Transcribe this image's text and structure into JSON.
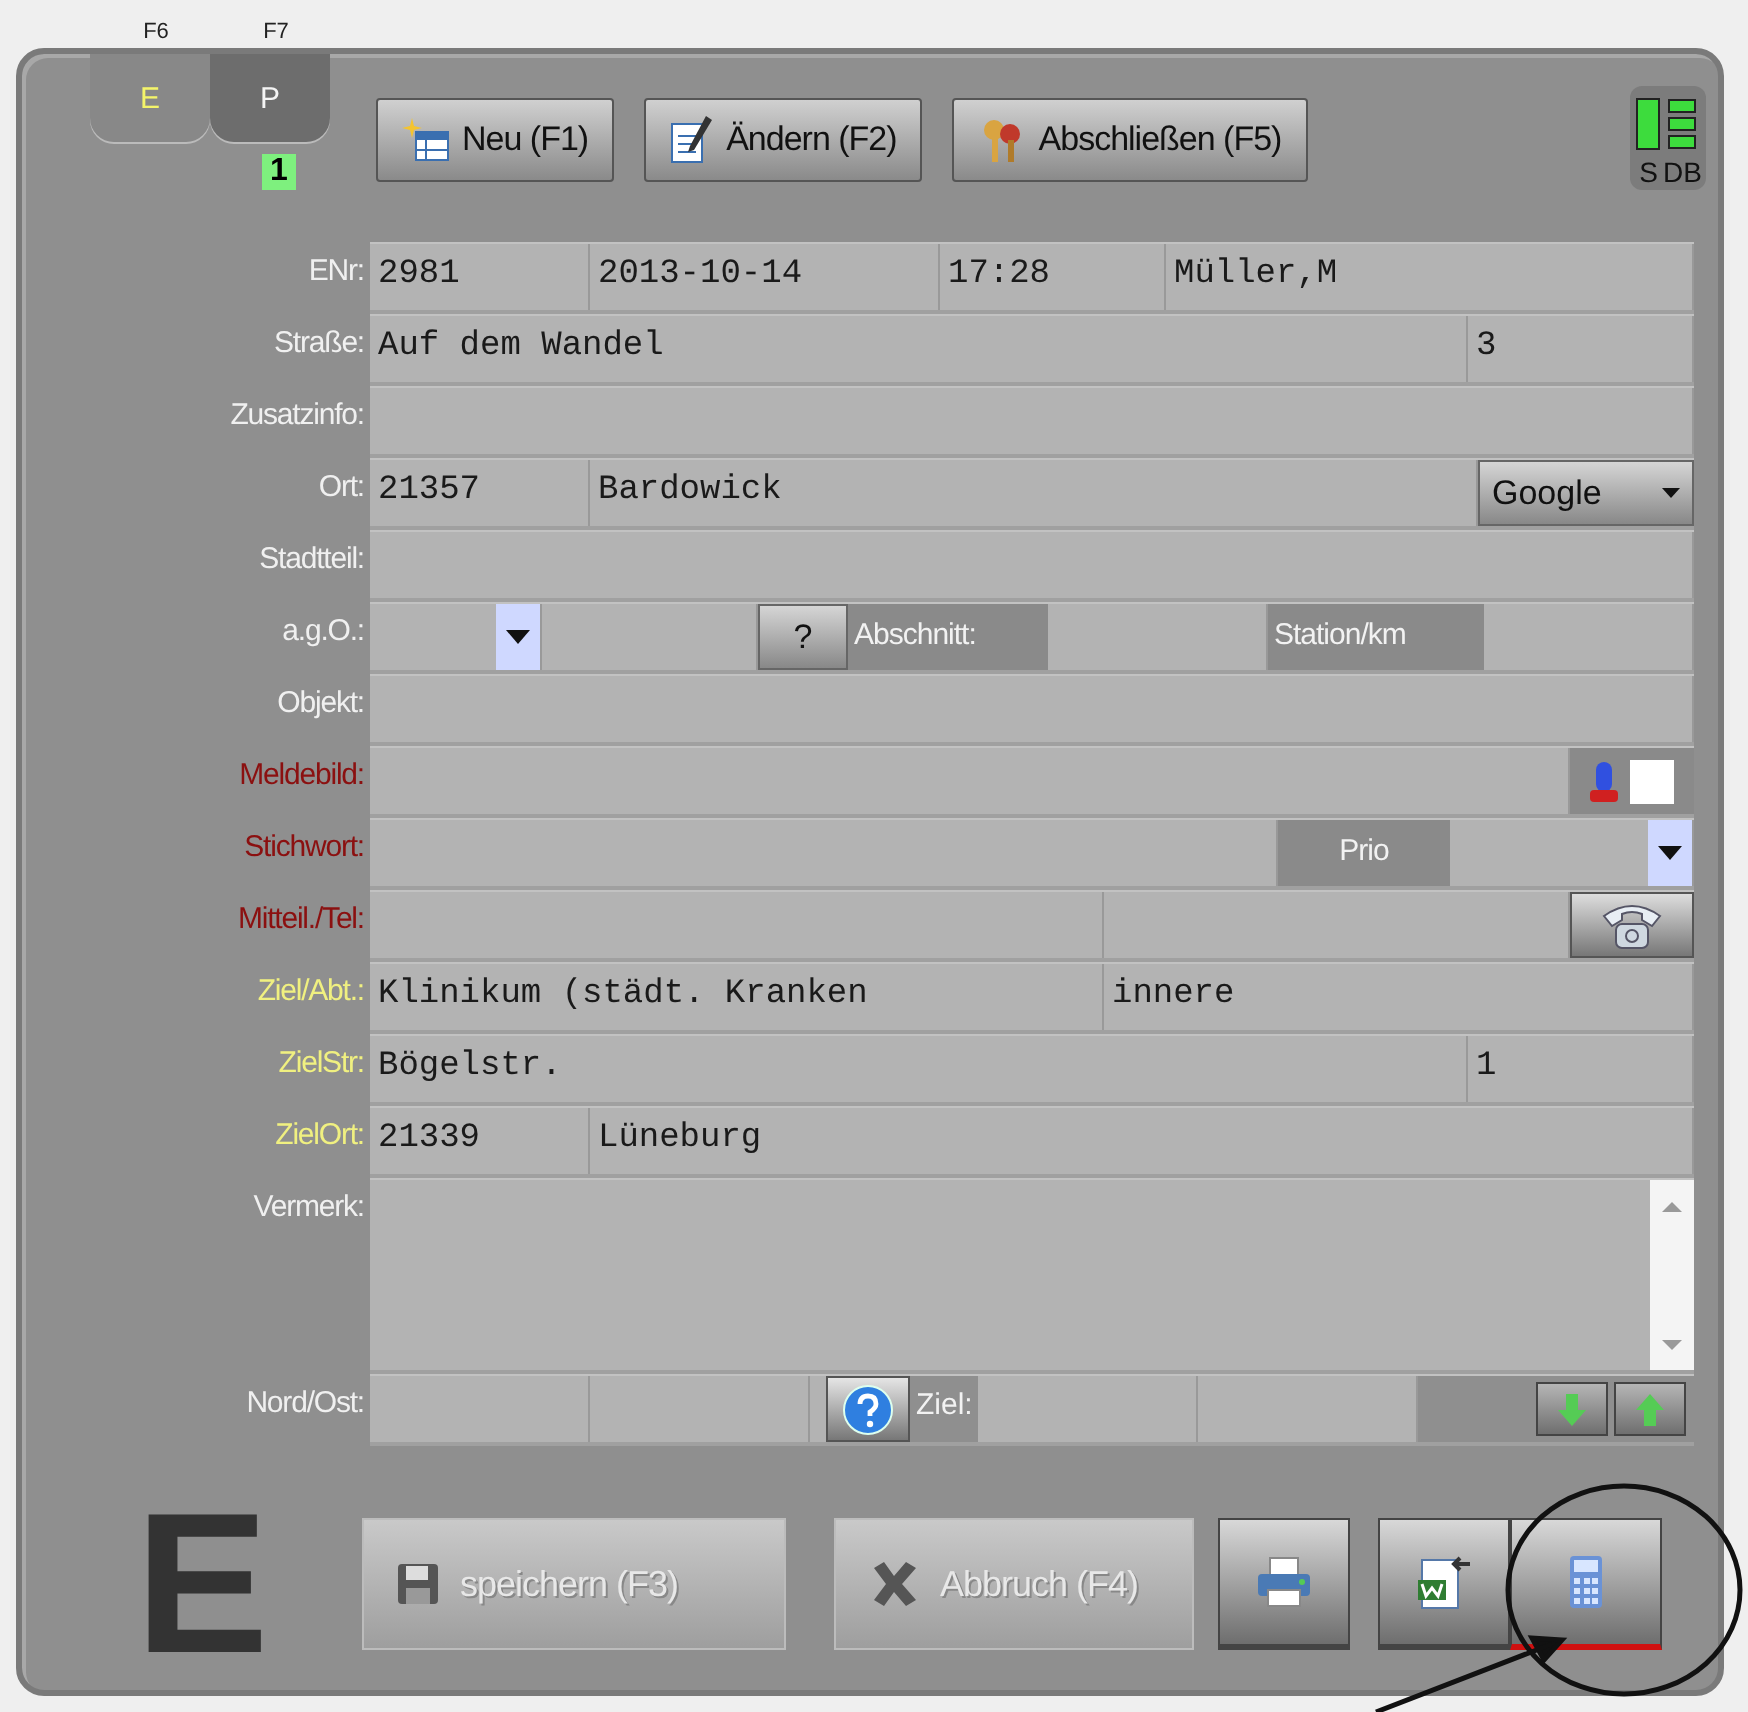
{
  "tabs": [
    {
      "key": "F6",
      "label": "E",
      "selected": true
    },
    {
      "key": "F7",
      "label": "P",
      "selected": false
    }
  ],
  "counter": "1",
  "toolbar": [
    {
      "kind": "new",
      "label": "Neu (F1)"
    },
    {
      "kind": "edit",
      "label": "Ändern (F2)"
    },
    {
      "kind": "close",
      "label": "Abschließen (F5)"
    }
  ],
  "status": {
    "s": "S",
    "db": "DB"
  },
  "rows": [
    {
      "label": "ENr:",
      "color": "#f0f0f0",
      "cells": [
        {
          "kind": "short",
          "value": "2981"
        },
        {
          "kind": "date",
          "value": "2013-10-14"
        },
        {
          "kind": "mid",
          "value": "17:28"
        },
        {
          "kind": "field",
          "value": "Müller,M"
        }
      ]
    },
    {
      "label": "Straße:",
      "color": "#f0f0f0",
      "cells": [
        {
          "kind": "field",
          "value": "Auf dem Wandel"
        },
        {
          "kind": "mid",
          "value": "3"
        }
      ]
    },
    {
      "label": "Zusatzinfo:",
      "color": "#f0f0f0",
      "cells": [
        {
          "kind": "field"
        }
      ]
    },
    {
      "label": "Ort:",
      "color": "#f0f0f0",
      "cells": [
        {
          "kind": "short",
          "value": "21357"
        },
        {
          "kind": "field",
          "value": "Bardowick"
        },
        {
          "kind": "menu-button",
          "label": "Google"
        }
      ]
    },
    {
      "label": "Stadtteil:",
      "color": "#f0f0f0",
      "cells": [
        {
          "kind": "field"
        }
      ]
    },
    {
      "label": "a.g.O.:",
      "color": "#f0f0f0",
      "cells": [
        {
          "kind": "combo"
        },
        {
          "kind": "small"
        },
        {
          "kind": "help-button",
          "label": "?"
        },
        {
          "kind": "caption",
          "label": "Abschnitt:"
        },
        {
          "kind": "short"
        },
        {
          "kind": "caption",
          "label": "Station/km"
        },
        {
          "kind": "field"
        }
      ]
    },
    {
      "label": "Objekt:",
      "color": "#f0f0f0",
      "cells": [
        {
          "kind": "field"
        }
      ]
    },
    {
      "label": "Meldebild:",
      "color": "#8b1010",
      "cells": [
        {
          "kind": "field"
        },
        {
          "kind": "siren-check",
          "checked": false
        }
      ]
    },
    {
      "label": "Stichwort:",
      "color": "#8b1010",
      "cells": [
        {
          "kind": "field"
        },
        {
          "kind": "caption",
          "label": "Prio"
        },
        {
          "kind": "combo-wide"
        }
      ]
    },
    {
      "label": "Mitteil./Tel:",
      "color": "#8b1010",
      "cells": [
        {
          "kind": "wide"
        },
        {
          "kind": "field"
        },
        {
          "kind": "phone-button"
        }
      ]
    },
    {
      "label": "Ziel/Abt.:",
      "color": "#f0f080",
      "cells": [
        {
          "kind": "wide",
          "value": "Klinikum (städt. Kranken"
        },
        {
          "kind": "field",
          "value": "innere"
        }
      ]
    },
    {
      "label": "ZielStr:",
      "color": "#f0f080",
      "cells": [
        {
          "kind": "field",
          "value": "Bögelstr."
        },
        {
          "kind": "mid",
          "value": "1"
        }
      ]
    },
    {
      "label": "ZielOrt:",
      "color": "#f0f080",
      "cells": [
        {
          "kind": "short",
          "value": "21339"
        },
        {
          "kind": "field",
          "value": "Lüneburg"
        }
      ]
    },
    {
      "label": "Vermerk:",
      "color": "#f0f0f0",
      "cells": [
        {
          "kind": "memo"
        }
      ]
    },
    {
      "label": "Nord/Ost:",
      "color": "#f0f0f0",
      "cells": [
        {
          "kind": "short"
        },
        {
          "kind": "short"
        },
        {
          "kind": "info-button"
        },
        {
          "kind": "caption-s",
          "label": "Ziel:"
        },
        {
          "kind": "short"
        },
        {
          "kind": "short"
        },
        {
          "kind": "spacer"
        },
        {
          "kind": "arrows"
        }
      ]
    }
  ],
  "mode_letter": "E",
  "actions": [
    {
      "kind": "save",
      "label": "speichern (F3)",
      "disabled": true
    },
    {
      "kind": "cancel",
      "label": "Abbruch (F4)",
      "disabled": true
    }
  ],
  "icon_buttons": [
    {
      "kind": "print",
      "selected": false
    },
    {
      "kind": "word",
      "selected": false
    },
    {
      "kind": "calculator",
      "selected": true
    }
  ]
}
